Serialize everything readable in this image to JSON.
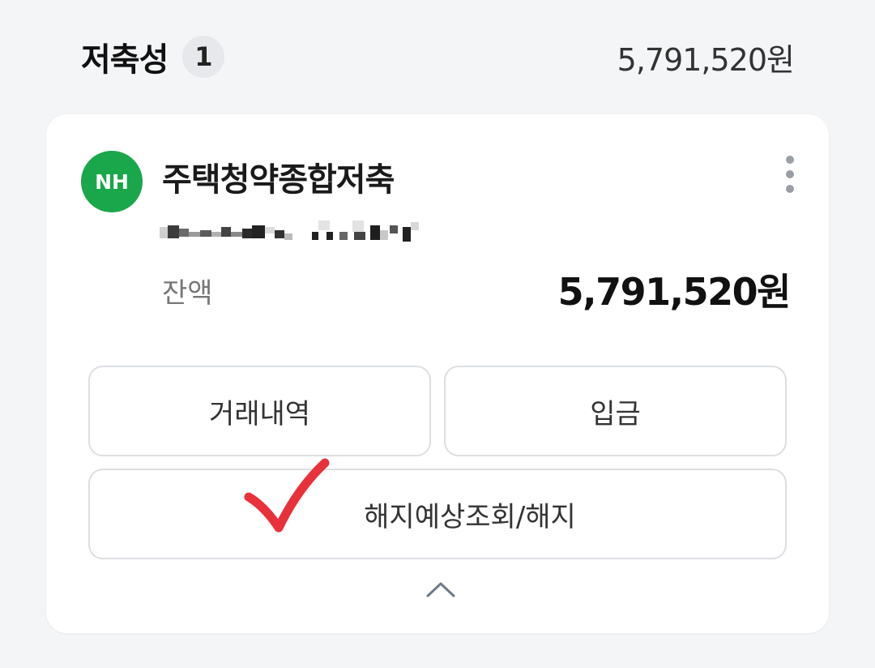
{
  "section": {
    "title": "저축성",
    "count": "1",
    "total": "5,791,520원"
  },
  "account": {
    "bank_logo_text": "NH",
    "bank_logo_color": "#1aa64a",
    "name": "주택청약종합저축",
    "balance_label": "잔액",
    "balance": "5,791,520원"
  },
  "actions": {
    "history_label": "거래내역",
    "deposit_label": "입금",
    "terminate_label": "해지예상조회/해지"
  },
  "icons": {
    "more": "more-vertical-icon",
    "collapse": "chevron-up-icon",
    "annotation": "red-checkmark"
  },
  "colors": {
    "accent_green": "#1aa64a",
    "checkmark_red": "#e8313a"
  }
}
